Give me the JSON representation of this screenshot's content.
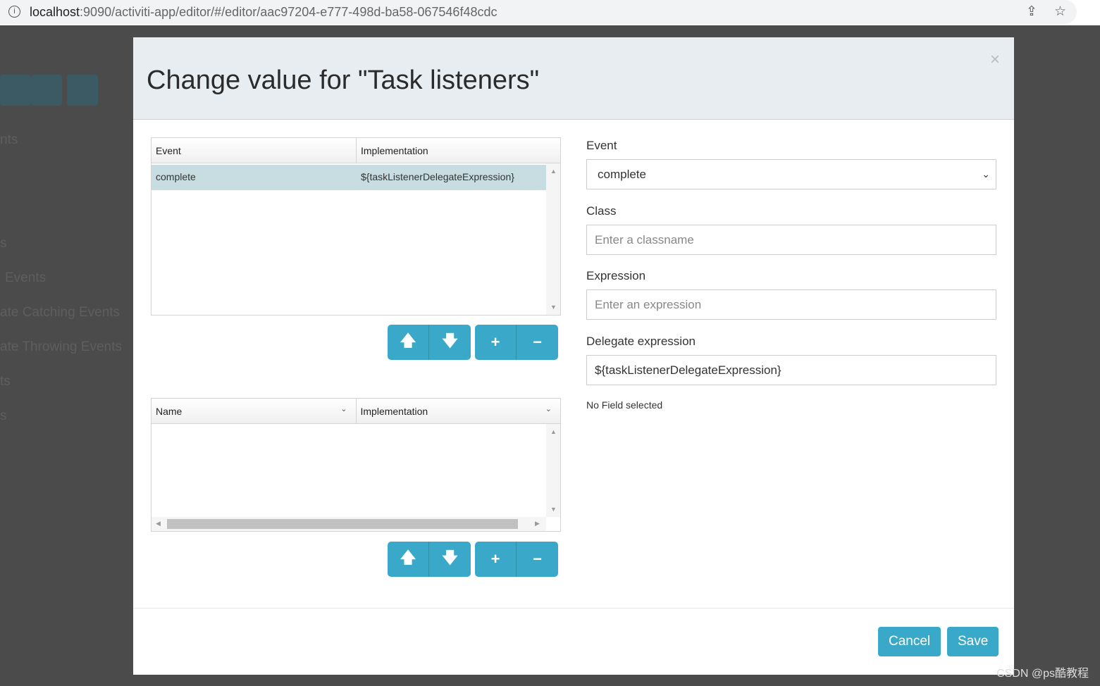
{
  "browser": {
    "url_host": "localhost",
    "url_rest": ":9090/activiti-app/editor/#/editor/aac97204-e777-498d-ba58-067546f48cdc"
  },
  "background": {
    "items": [
      "nts",
      "s",
      "Events",
      "ate Catching Events",
      "ate Throwing Events",
      "ts",
      "s"
    ]
  },
  "modal": {
    "title": "Change value for \"Task listeners\"",
    "close": "×",
    "listeners_grid": {
      "columns": [
        "Event",
        "Implementation"
      ],
      "rows": [
        {
          "event": "complete",
          "implementation": "${taskListenerDelegateExpression}"
        }
      ]
    },
    "fields_grid": {
      "columns": [
        "Name",
        "Implementation"
      ]
    },
    "buttons": {
      "up": "🡅",
      "down": "🡇",
      "add": "+",
      "remove": "−"
    },
    "form": {
      "event_label": "Event",
      "event_value": "complete",
      "class_label": "Class",
      "class_placeholder": "Enter a classname",
      "expression_label": "Expression",
      "expression_placeholder": "Enter an expression",
      "delegate_label": "Delegate expression",
      "delegate_value": "${taskListenerDelegateExpression}",
      "no_field": "No Field selected"
    },
    "footer": {
      "cancel": "Cancel",
      "save": "Save"
    }
  },
  "watermark": "CSDN @ps酷教程",
  "colors": {
    "accent": "#3aa8c8",
    "selected_row": "#c8dde1",
    "header_bg": "#e8edf1"
  }
}
